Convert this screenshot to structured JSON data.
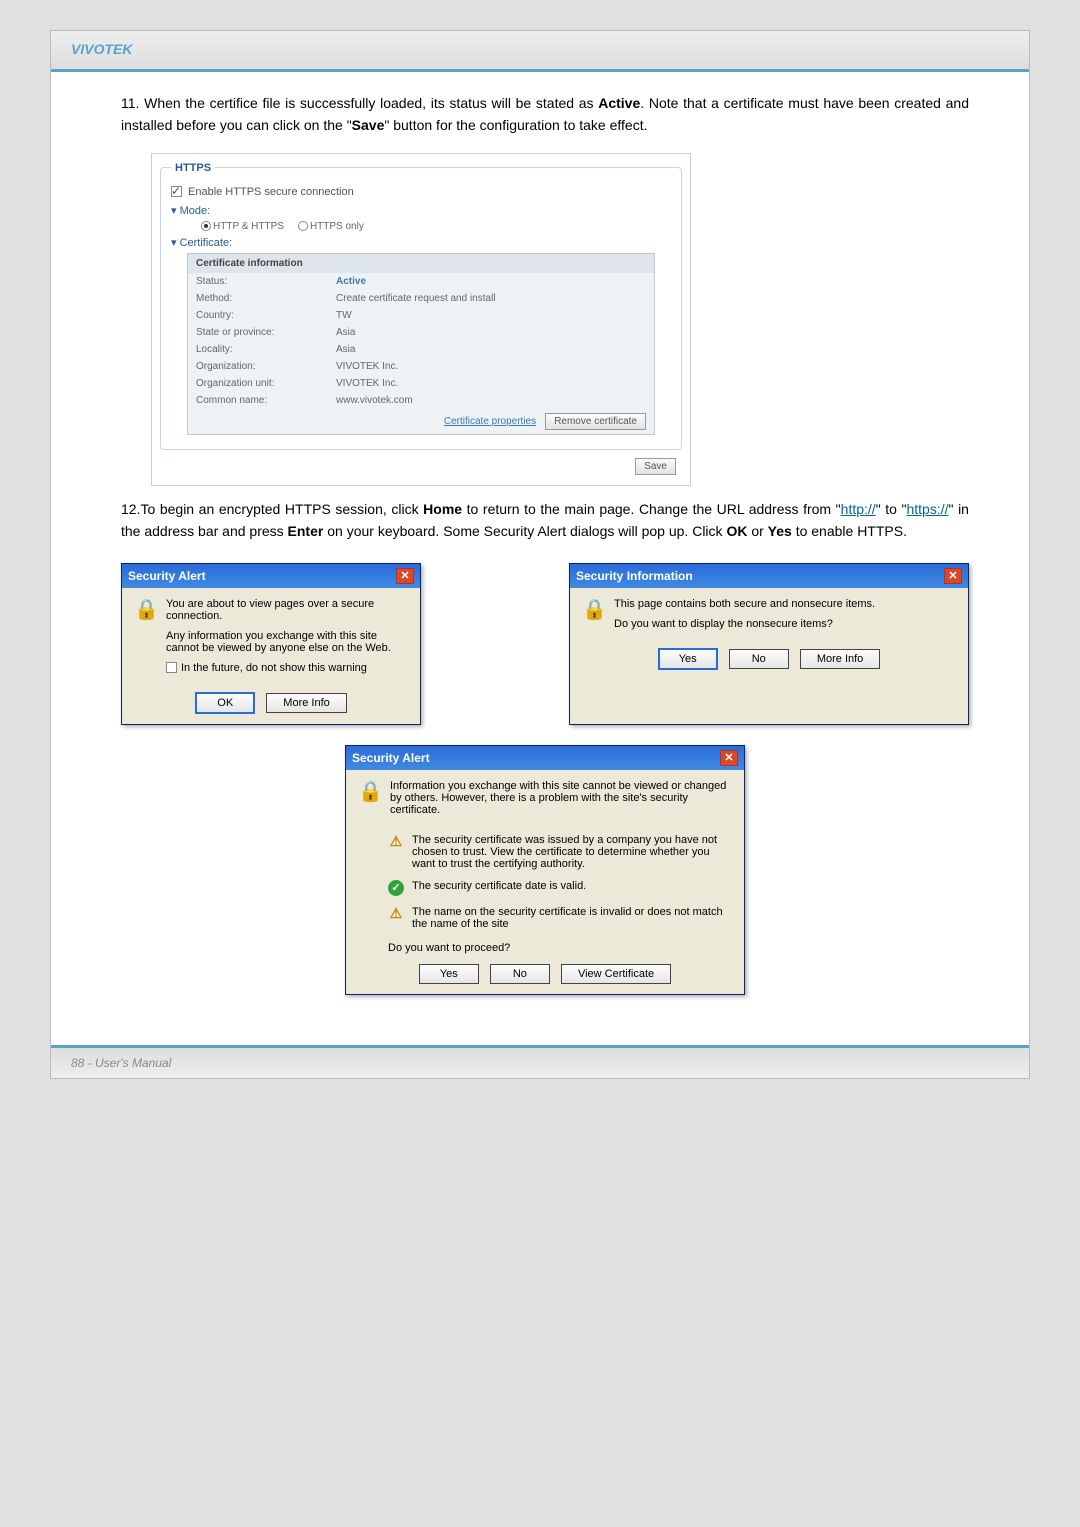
{
  "header": {
    "brand": "VIVOTEK"
  },
  "step11": {
    "num": "11.",
    "text_pre": "When the certifice file is successfully loaded, its status will be stated as ",
    "active": "Active",
    "text_mid": ". Note that a certificate must have been created and installed before you can click on the \"",
    "save": "Save",
    "text_end": "\" button for the configuration to take effect."
  },
  "screenshot1": {
    "legend": "HTTPS",
    "enable": "Enable HTTPS secure connection",
    "mode_label": "Mode:",
    "opt_both": "HTTP & HTTPS",
    "opt_https": "HTTPS only",
    "cert_label": "Certificate:",
    "table_head": "Certificate information",
    "rows": [
      {
        "k": "Status:",
        "v": "Active",
        "active": true
      },
      {
        "k": "Method:",
        "v": "Create certificate request and install"
      },
      {
        "k": "Country:",
        "v": "TW"
      },
      {
        "k": "State or province:",
        "v": "Asia"
      },
      {
        "k": "Locality:",
        "v": "Asia"
      },
      {
        "k": "Organization:",
        "v": "VIVOTEK Inc."
      },
      {
        "k": "Organization unit:",
        "v": "VIVOTEK Inc."
      },
      {
        "k": "Common name:",
        "v": "www.vivotek.com"
      }
    ],
    "cert_props": "Certificate properties",
    "remove": "Remove certificate",
    "save_btn": "Save"
  },
  "step12": {
    "num": "12.",
    "a": "To begin an encrypted HTTPS session, click ",
    "home": "Home",
    "b": " to return to the main page. Change the URL address from \"",
    "url1": "http://",
    "c": "\" to \"",
    "url2": "https://",
    "d": "\" in the address bar and press ",
    "enter": "Enter",
    "e": " on your keyboard. Some Security Alert dialogs will pop up. Click ",
    "ok": "OK",
    "f": " or ",
    "yes": "Yes",
    "g": " to enable HTTPS."
  },
  "dialog1": {
    "title": "Security Alert",
    "line1": "You are about to view pages over a secure connection.",
    "line2": "Any information you exchange with this site cannot be viewed by anyone else on the Web.",
    "chk": "In the future, do not show this warning",
    "ok": "OK",
    "more": "More Info"
  },
  "dialog2": {
    "title": "Security Information",
    "line1": "This page contains both secure and nonsecure items.",
    "line2": "Do you want to display the nonsecure items?",
    "yes": "Yes",
    "no": "No",
    "more": "More Info"
  },
  "dialog3": {
    "title": "Security Alert",
    "intro": "Information you exchange with this site cannot be viewed or changed by others. However, there is a problem with the site's security certificate.",
    "b1": "The security certificate was issued by a company you have not chosen to trust. View the certificate to determine whether you want to trust the certifying authority.",
    "b2": "The security certificate date is valid.",
    "b3": "The name on the security certificate is invalid or does not match the name of the site",
    "q": "Do you want to proceed?",
    "yes": "Yes",
    "no": "No",
    "view": "View Certificate"
  },
  "footer": {
    "text": "88 - User's Manual"
  }
}
